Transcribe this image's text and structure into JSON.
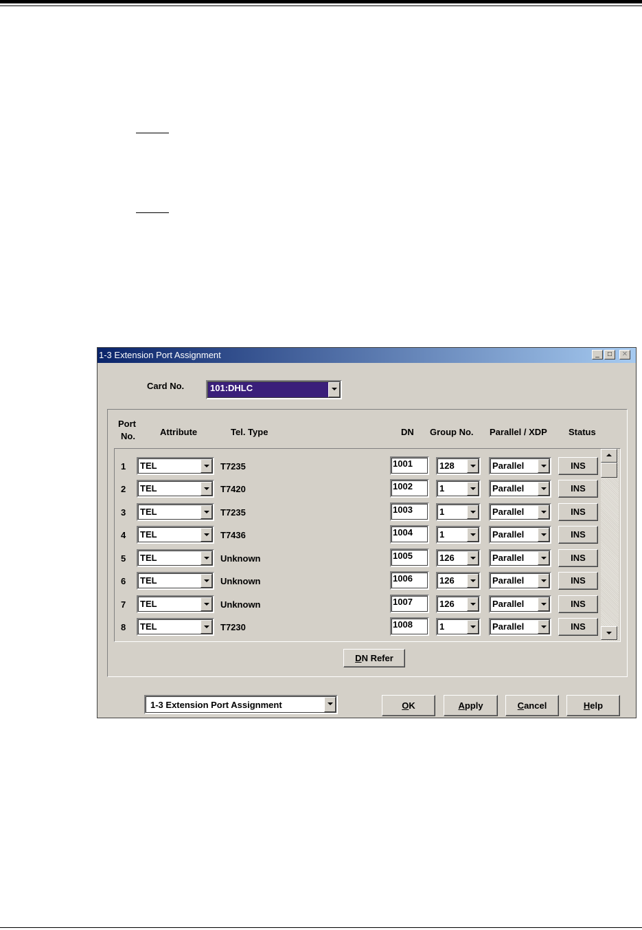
{
  "window": {
    "title": "1-3 Extension Port Assignment",
    "minimize_glyph": "_",
    "maximize_glyph": "□",
    "close_glyph": "✕"
  },
  "card": {
    "label": "Card No.",
    "selected": "101:DHLC"
  },
  "columns": {
    "port_line1": "Port",
    "port_line2": "No.",
    "attribute": "Attribute",
    "tel_type": "Tel. Type",
    "dn": "DN",
    "group_no": "Group No.",
    "parallel_xdp": "Parallel / XDP",
    "status": "Status"
  },
  "rows": [
    {
      "port": "1",
      "attribute": "TEL",
      "tel_type": "T7235",
      "dn": "1001",
      "group": "128",
      "parallel": "Parallel",
      "status": "INS"
    },
    {
      "port": "2",
      "attribute": "TEL",
      "tel_type": "T7420",
      "dn": "1002",
      "group": "1",
      "parallel": "Parallel",
      "status": "INS"
    },
    {
      "port": "3",
      "attribute": "TEL",
      "tel_type": "T7235",
      "dn": "1003",
      "group": "1",
      "parallel": "Parallel",
      "status": "INS"
    },
    {
      "port": "4",
      "attribute": "TEL",
      "tel_type": "T7436",
      "dn": "1004",
      "group": "1",
      "parallel": "Parallel",
      "status": "INS"
    },
    {
      "port": "5",
      "attribute": "TEL",
      "tel_type": "Unknown",
      "dn": "1005",
      "group": "126",
      "parallel": "Parallel",
      "status": "INS"
    },
    {
      "port": "6",
      "attribute": "TEL",
      "tel_type": "Unknown",
      "dn": "1006",
      "group": "126",
      "parallel": "Parallel",
      "status": "INS"
    },
    {
      "port": "7",
      "attribute": "TEL",
      "tel_type": "Unknown",
      "dn": "1007",
      "group": "126",
      "parallel": "Parallel",
      "status": "INS"
    },
    {
      "port": "8",
      "attribute": "TEL",
      "tel_type": "T7230",
      "dn": "1008",
      "group": "1",
      "parallel": "Parallel",
      "status": "INS"
    }
  ],
  "buttons": {
    "dn_refer_mnemonic": "D",
    "dn_refer_rest": "N Refer",
    "ok_mnemonic": "O",
    "ok_rest": "K",
    "apply_mnemonic": "A",
    "apply_rest": "pply",
    "cancel_mnemonic": "C",
    "cancel_rest": "ancel",
    "help_mnemonic": "H",
    "help_rest": "elp"
  },
  "footer": {
    "screen_select": "1-3 Extension Port Assignment"
  },
  "colors": {
    "title_start": "#0a246a",
    "title_end": "#a6caf0",
    "dialog_face": "#d4d0c8",
    "selection": "#3a1f7a"
  }
}
